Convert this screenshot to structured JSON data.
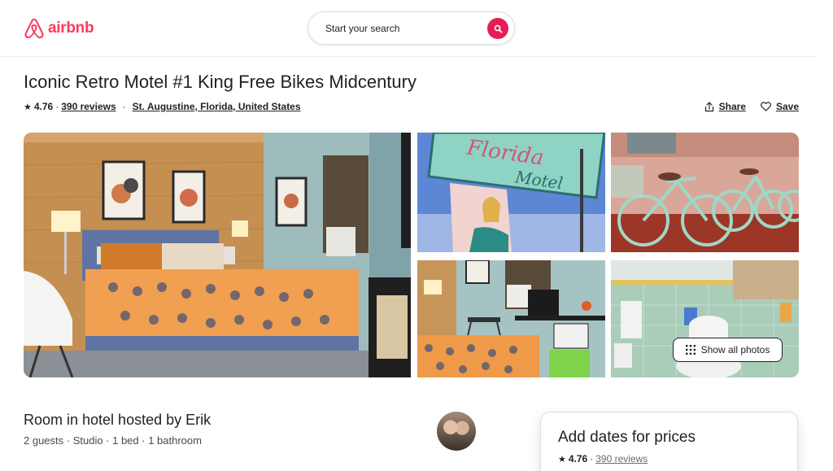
{
  "header": {
    "logo_text": "airbnb",
    "search_placeholder": "Start your search"
  },
  "listing": {
    "title": "Iconic Retro Motel #1 King Free Bikes Midcentury",
    "rating": "4.76",
    "reviews": "390 reviews",
    "location": "St. Augustine, Florida, United States",
    "share_label": "Share",
    "save_label": "Save"
  },
  "gallery": {
    "photos": [
      "bedroom",
      "florida-motel-sign",
      "bicycles",
      "room-desk",
      "bathroom"
    ],
    "show_all_label": "Show all photos"
  },
  "host": {
    "title": "Room in hotel hosted by Erik",
    "details": "2 guests · Studio · 1 bed · 1 bathroom"
  },
  "booking": {
    "title": "Add dates for prices",
    "rating": "4.76",
    "reviews": "390 reviews"
  },
  "colors": {
    "brand": "#ff385c",
    "search_button": "#e51d54",
    "text": "#222222"
  },
  "icons": [
    "airbnb-logo-icon",
    "search-icon",
    "star-icon",
    "share-icon",
    "heart-icon",
    "grid-icon"
  ]
}
